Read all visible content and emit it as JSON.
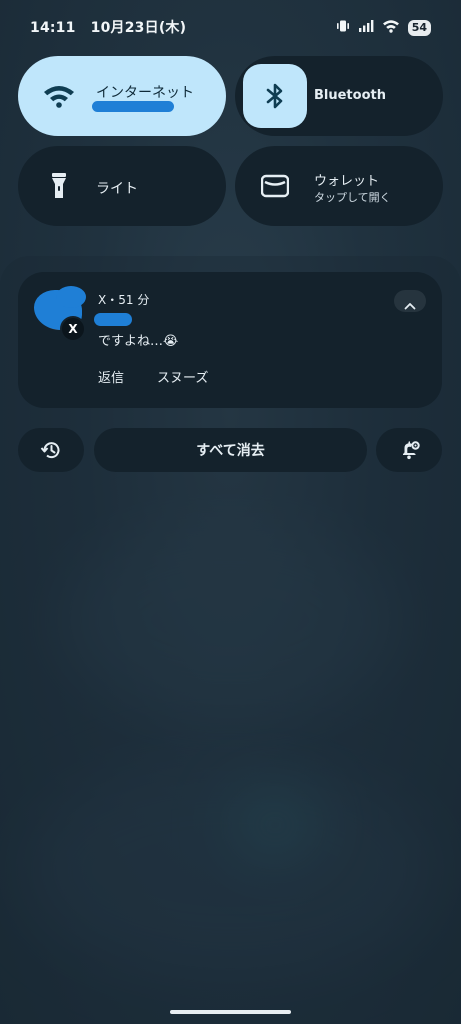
{
  "status_bar": {
    "time": "14:11",
    "date": "10月23日(木)",
    "battery_level": "54",
    "icons": [
      "vibrate-icon",
      "signal-icon",
      "wifi-icon",
      "battery-icon"
    ]
  },
  "quick_settings": {
    "tiles": [
      {
        "id": "internet",
        "label": "インターネット",
        "subtitle_redacted": true,
        "active": true,
        "icon": "wifi-icon"
      },
      {
        "id": "bluetooth",
        "label": "Bluetooth",
        "active": true,
        "icon": "bluetooth-icon"
      },
      {
        "id": "flashlight",
        "label": "ライト",
        "active": false,
        "icon": "flashlight-icon"
      },
      {
        "id": "wallet",
        "label": "ウォレット",
        "subtitle": "タップして開く",
        "active": false,
        "icon": "wallet-icon"
      }
    ]
  },
  "notification": {
    "app_name": "X",
    "separator": "・",
    "time_ago": "51 分",
    "sender_redacted": true,
    "message": "ですよね…😭",
    "actions": {
      "reply": "返信",
      "snooze": "スヌーズ"
    },
    "collapse_icon": "chevron-up-icon",
    "app_badge_icon": "x-logo-icon"
  },
  "bottom_controls": {
    "history_icon": "history-icon",
    "clear_all_label": "すべて消去",
    "settings_icon": "notification-settings-icon"
  },
  "colors": {
    "active_tile": "#bfe6fb",
    "inactive_tile": "#14222c",
    "redaction": "#1f7fd6",
    "background": "#20323f"
  }
}
